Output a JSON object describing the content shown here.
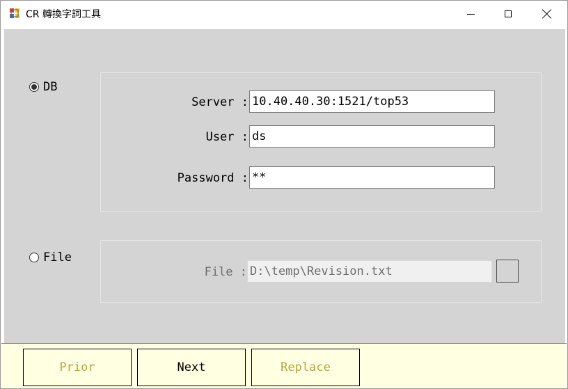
{
  "window": {
    "title": "CR 轉換字詞工具",
    "icon": "winforms-app-icon",
    "controls": {
      "minimize": "minimize-icon",
      "maximize": "maximize-icon",
      "close": "close-icon"
    }
  },
  "db_option": {
    "label": "DB",
    "selected": true
  },
  "file_option": {
    "label": "File",
    "selected": false
  },
  "db_fields": {
    "server": {
      "label": "Server :",
      "value": "10.40.40.30:1521/top53"
    },
    "user": {
      "label": "User :",
      "value": "ds"
    },
    "password": {
      "label": "Password :",
      "value": "**"
    }
  },
  "file_fields": {
    "file": {
      "label": "File :",
      "value": "D:\\temp\\Revision.txt",
      "enabled": false
    }
  },
  "buttons": {
    "prior": {
      "label": "Prior",
      "enabled": false
    },
    "next": {
      "label": "Next",
      "enabled": true
    },
    "replace": {
      "label": "Replace",
      "enabled": false
    }
  },
  "colors": {
    "client_bg": "#d4d4d4",
    "button_bar_bg": "#ffffe1",
    "disabled_button_text": "#b5a642"
  }
}
